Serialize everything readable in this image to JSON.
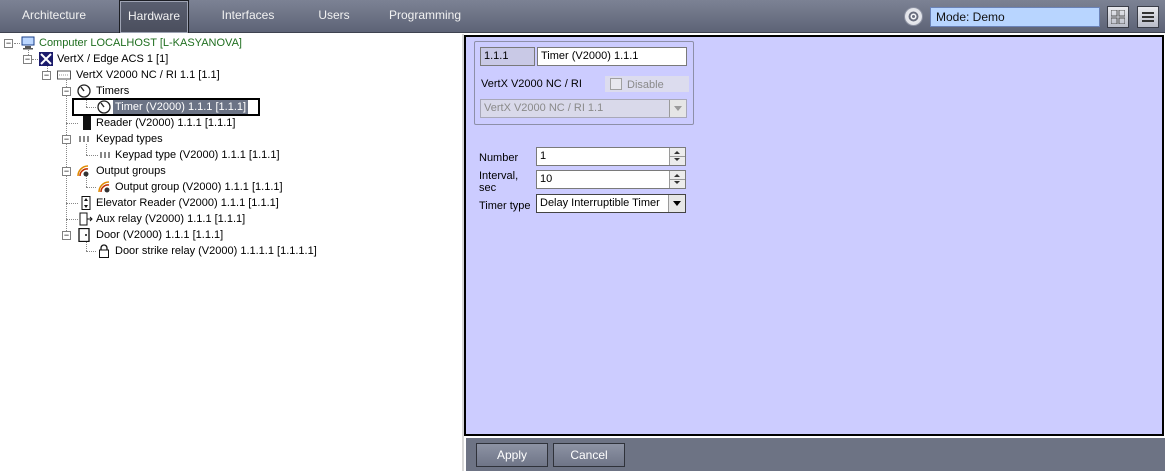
{
  "tabs": [
    {
      "label": "Architecture",
      "active": false
    },
    {
      "label": "Hardware",
      "active": true
    },
    {
      "label": "Interfaces",
      "active": false
    },
    {
      "label": "Users",
      "active": false
    },
    {
      "label": "Programming",
      "active": false
    }
  ],
  "mode": {
    "label": "Mode: Demo"
  },
  "tree": {
    "computer": "Computer LOCALHOST [L-KASYANOVA]",
    "vertx_edge": "VertX / Edge ACS 1 [1]",
    "vertx_v2000": "VertX V2000 NC / RI 1.1 [1.1]",
    "timers": "Timers",
    "timer": "Timer (V2000) 1.1.1 [1.1.1]",
    "reader": "Reader (V2000) 1.1.1 [1.1.1]",
    "keypad_types": "Keypad types",
    "keypad_type": "Keypad type (V2000) 1.1.1 [1.1.1]",
    "output_groups": "Output groups",
    "output_group": "Output group (V2000) 1.1.1 [1.1.1]",
    "elevator_reader": "Elevator Reader (V2000) 1.1.1 [1.1.1]",
    "aux_relay": "Aux relay (V2000) 1.1.1 [1.1.1]",
    "door": "Door (V2000) 1.1.1 [1.1.1]",
    "door_strike": "Door strike relay (V2000) 1.1.1.1 [1.1.1.1]"
  },
  "form": {
    "id": "1.1.1",
    "name": "Timer (V2000) 1.1.1",
    "parent_label": "VertX V2000 NC / RI",
    "disable_label": "Disable",
    "disable_checked": false,
    "parent_select": "VertX V2000 NC / RI 1.1",
    "number_label": "Number",
    "number_value": "1",
    "interval_label_1": "Interval,",
    "interval_label_2": "sec",
    "interval_value": "10",
    "timer_type_label": "Timer type",
    "timer_type_value": "Delay Interruptible Timer"
  },
  "buttons": {
    "apply": "Apply",
    "cancel": "Cancel"
  },
  "colors": {
    "panel_bg": "#ccccff",
    "nav_bg": "#6d7384",
    "mode_bg": "#b8d5ff",
    "computer_text": "#1f6e1f"
  }
}
